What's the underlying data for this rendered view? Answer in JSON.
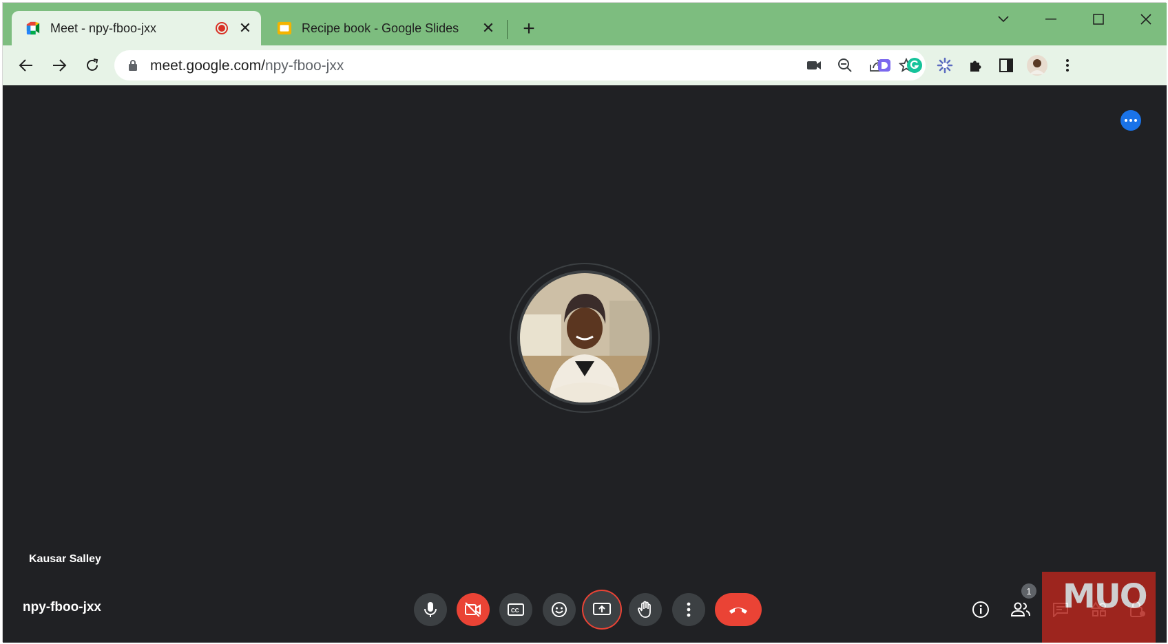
{
  "browser": {
    "tabs": [
      {
        "title": "Meet - npy-fboo-jxx",
        "icon": "google-meet-icon",
        "recording": true,
        "active": true
      },
      {
        "title": "Recipe book - Google Slides",
        "icon": "google-slides-icon",
        "active": false
      }
    ],
    "new_tab_label": "+",
    "address": {
      "host": "meet.google.com/",
      "path": "npy-fboo-jxx"
    },
    "colors": {
      "tabstrip": "#7dbd7f",
      "toolbar": "#e7f3e7"
    }
  },
  "meet": {
    "participant_name": "Kausar Salley",
    "meeting_code": "npy-fboo-jxx",
    "people_count": "1",
    "controls": [
      {
        "name": "microphone",
        "state": "on"
      },
      {
        "name": "camera",
        "state": "off"
      },
      {
        "name": "captions",
        "state": "off"
      },
      {
        "name": "reactions"
      },
      {
        "name": "present-screen",
        "state": "highlighted"
      },
      {
        "name": "raise-hand"
      },
      {
        "name": "more-options"
      },
      {
        "name": "leave-call"
      }
    ],
    "colors": {
      "background": "#202124",
      "control": "#3c4043",
      "danger": "#ea4335",
      "accent": "#1a73e8"
    }
  },
  "watermark": {
    "text": "MUO"
  }
}
